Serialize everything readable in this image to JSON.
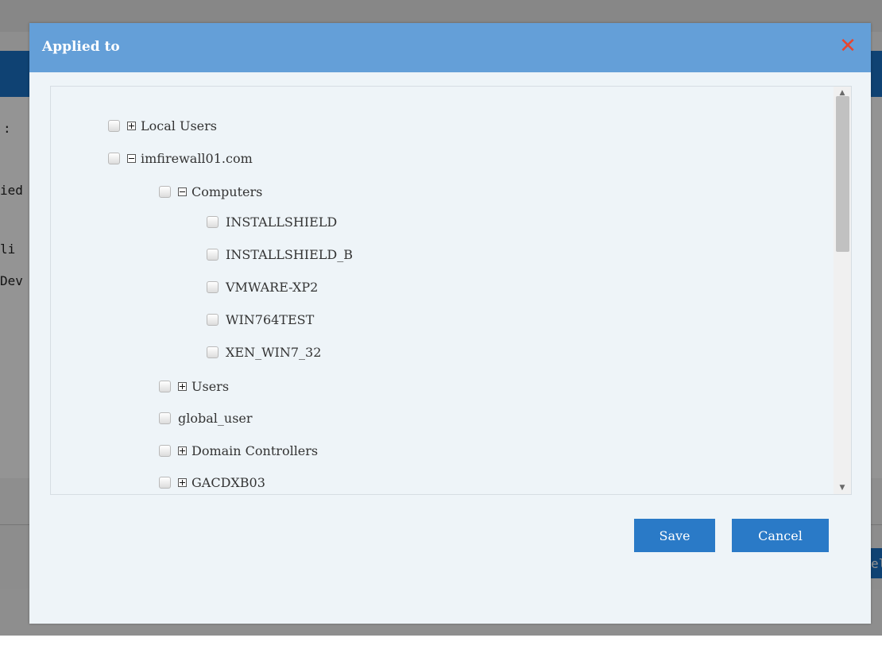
{
  "background": {
    "fragment_colon": ":",
    "fragment_ied": "ied",
    "fragment_li": "li",
    "fragment_dev": "Dev",
    "fragment_el": "el"
  },
  "dialog": {
    "title": "Applied to",
    "close_glyph": "✕",
    "save_label": "Save",
    "cancel_label": "Cancel",
    "tree": [
      {
        "label": "Local Users",
        "toggle": "expand"
      },
      {
        "label": "imfirewall01.com",
        "toggle": "collapse"
      },
      {
        "label": "Computers",
        "toggle": "collapse"
      },
      {
        "label": "INSTALLSHIELD",
        "toggle": "none"
      },
      {
        "label": "INSTALLSHIELD_B",
        "toggle": "none"
      },
      {
        "label": "VMWARE-XP2",
        "toggle": "none"
      },
      {
        "label": "WIN764TEST",
        "toggle": "none"
      },
      {
        "label": "XEN_WIN7_32",
        "toggle": "none"
      },
      {
        "label": "Users",
        "toggle": "expand"
      },
      {
        "label": "global_user",
        "toggle": "none"
      },
      {
        "label": "Domain Controllers",
        "toggle": "expand"
      },
      {
        "label": "GACDXB03",
        "toggle": "expand"
      }
    ]
  },
  "colors": {
    "header": "#649fd8",
    "close": "#e8452e",
    "button": "#2a7ac7",
    "dialog_bg": "#eef4f8"
  }
}
